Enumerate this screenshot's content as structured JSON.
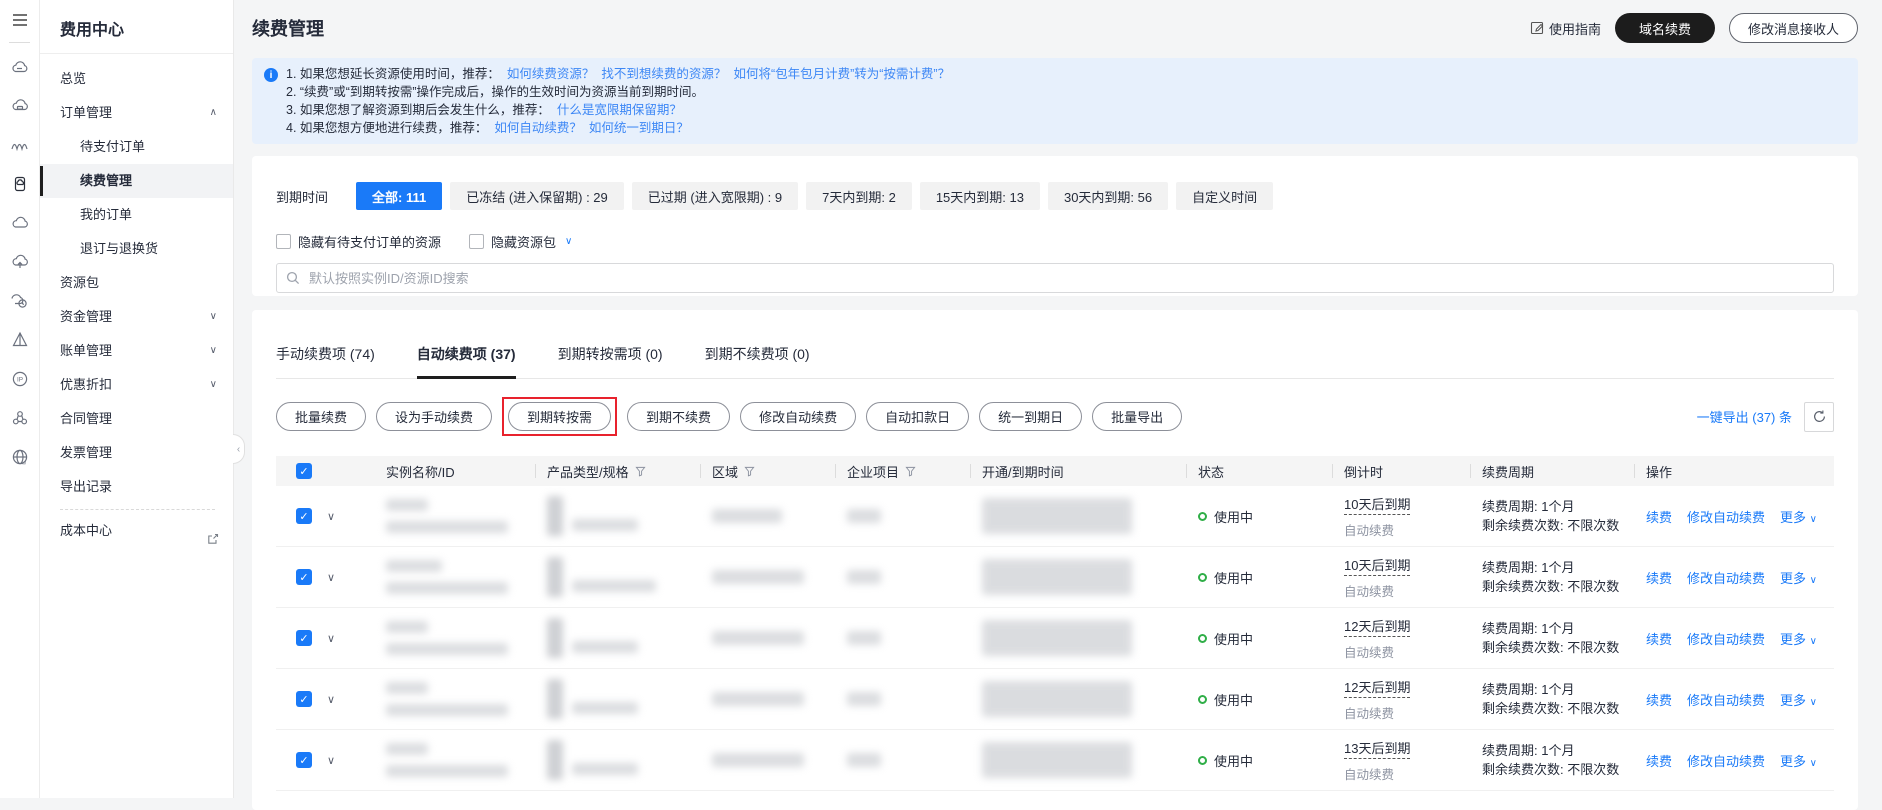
{
  "colors": {
    "accent": "#1a7af8",
    "status_green": "#2fae47",
    "highlight_red": "#e8222d",
    "notice_bg": "#e7f0fc"
  },
  "icon_rail": {
    "icons": [
      "menu-icon",
      "cloud-server-icon",
      "cloud-card-icon",
      "wave-icon",
      "server-panel-icon",
      "cloud-icon",
      "cloud-upload-icon",
      "cloud-clock-icon",
      "prism-icon",
      "ip-icon",
      "cluster-icon",
      "globe-icon"
    ]
  },
  "sidebar": {
    "title": "费用中心",
    "items": [
      {
        "label": "总览"
      },
      {
        "label": "订单管理"
      },
      {
        "label": "待支付订单"
      },
      {
        "label": "续费管理"
      },
      {
        "label": "我的订单"
      },
      {
        "label": "退订与退换货"
      },
      {
        "label": "资源包"
      },
      {
        "label": "资金管理"
      },
      {
        "label": "账单管理"
      },
      {
        "label": "优惠折扣"
      },
      {
        "label": "合同管理"
      },
      {
        "label": "发票管理"
      },
      {
        "label": "导出记录"
      },
      {
        "label": "成本中心"
      }
    ]
  },
  "header": {
    "title": "续费管理",
    "guide_label": "使用指南",
    "domain_renew_label": "域名续费",
    "modify_receiver_label": "修改消息接收人"
  },
  "notice": {
    "lines": [
      {
        "prefix": "1. 如果您想延长资源使用时间，推荐：",
        "links": [
          "如何续费资源？",
          "找不到想续费的资源？",
          "如何将“包年包月计费”转为“按需计费”？"
        ]
      },
      {
        "prefix": "2. “续费”或“到期转按需”操作完成后，操作的生效时间为资源当前到期时间。",
        "links": []
      },
      {
        "prefix": "3. 如果您想了解资源到期后会发生什么，推荐：",
        "links": [
          "什么是宽限期保留期？"
        ]
      },
      {
        "prefix": "4. 如果您想方便地进行续费，推荐：",
        "links": [
          "如何自动续费？",
          "如何统一到期日？"
        ]
      }
    ]
  },
  "filters": {
    "label": "到期时间",
    "options": [
      {
        "label": "全部: 111",
        "active": true
      },
      {
        "label": "已冻结 (进入保留期) : 29"
      },
      {
        "label": "已过期 (进入宽限期) : 9"
      },
      {
        "label": "7天内到期: 2"
      },
      {
        "label": "15天内到期: 13"
      },
      {
        "label": "30天内到期: 56"
      },
      {
        "label": "自定义时间"
      }
    ],
    "checkbox1": "隐藏有待支付订单的资源",
    "checkbox2": "隐藏资源包",
    "search_placeholder": "默认按照实例ID/资源ID搜索"
  },
  "tabs": [
    {
      "label": "手动续费项 (74)"
    },
    {
      "label": "自动续费项 (37)",
      "active": true
    },
    {
      "label": "到期转按需项 (0)"
    },
    {
      "label": "到期不续费项 (0)"
    }
  ],
  "toolbar": {
    "buttons": [
      "批量续费",
      "设为手动续费",
      "到期转按需",
      "到期不续费",
      "修改自动续费",
      "自动扣款日",
      "统一到期日",
      "批量导出"
    ],
    "highlighted": "到期转按需",
    "export_label": "一键导出 (37) 条"
  },
  "table": {
    "columns": [
      "实例名称/ID",
      "产品类型/规格",
      "区域",
      "企业项目",
      "开通/到期时间",
      "状态",
      "倒计时",
      "续费周期",
      "操作"
    ],
    "rows": [
      {
        "status": "使用中",
        "countdown": "10天后到期",
        "renew_mode": "自动续费",
        "period": "续费周期: 1个月",
        "remaining": "剩余续费次数: 不限次数",
        "action1": "续费",
        "action2": "修改自动续费",
        "action3": "更多"
      },
      {
        "status": "使用中",
        "countdown": "10天后到期",
        "renew_mode": "自动续费",
        "period": "续费周期: 1个月",
        "remaining": "剩余续费次数: 不限次数",
        "action1": "续费",
        "action2": "修改自动续费",
        "action3": "更多"
      },
      {
        "status": "使用中",
        "countdown": "12天后到期",
        "renew_mode": "自动续费",
        "period": "续费周期: 1个月",
        "remaining": "剩余续费次数: 不限次数",
        "action1": "续费",
        "action2": "修改自动续费",
        "action3": "更多"
      },
      {
        "status": "使用中",
        "countdown": "12天后到期",
        "renew_mode": "自动续费",
        "period": "续费周期: 1个月",
        "remaining": "剩余续费次数: 不限次数",
        "action1": "续费",
        "action2": "修改自动续费",
        "action3": "更多"
      },
      {
        "status": "使用中",
        "countdown": "13天后到期",
        "renew_mode": "自动续费",
        "period": "续费周期: 1个月",
        "remaining": "剩余续费次数: 不限次数",
        "action1": "续费",
        "action2": "修改自动续费",
        "action3": "更多"
      }
    ]
  }
}
